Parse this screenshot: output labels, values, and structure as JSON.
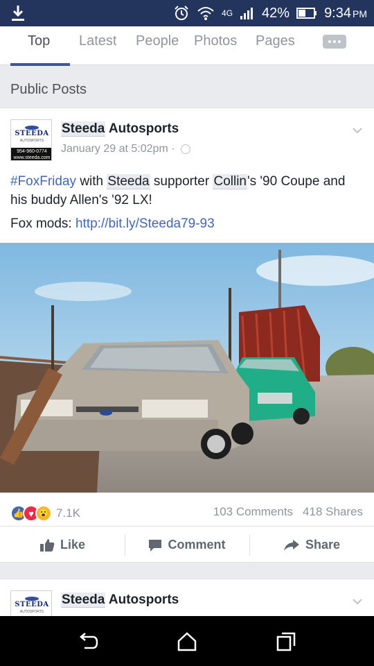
{
  "status_bar": {
    "network": "4G",
    "battery": "42%",
    "time": "9:34",
    "ampm": "PM",
    "icons": [
      "download-icon",
      "alarm-icon",
      "wifi-icon",
      "signal-icon",
      "battery-icon"
    ]
  },
  "tabs": [
    "Top",
    "Latest",
    "People",
    "Photos",
    "Pages"
  ],
  "section_title": "Public Posts",
  "post": {
    "logo": {
      "brand": "STEEDA",
      "sub": "AUTOSPORTS",
      "phone": "954-960-0774",
      "web": "www.steeda.com"
    },
    "poster_first": "Steeda",
    "poster_rest": "Autosports",
    "timestamp": "January 29 at 5:02pm ·",
    "text": {
      "hashtag": "#FoxFriday",
      "p1": "with",
      "mention1": "Steeda",
      "p2": "supporter",
      "mention2": "Collin",
      "p3": "'s '90 Coupe and his buddy Allen's '92 LX!",
      "mods_label": "Fox mods:",
      "mods_link": "http://bit.ly/Steeda79-93"
    },
    "reaction_count": "7.1K",
    "comments": "103 Comments",
    "shares": "418 Shares",
    "actions": {
      "like": "Like",
      "comment": "Comment",
      "share": "Share"
    }
  },
  "post2": {
    "poster_first": "Steeda",
    "poster_rest": "Autosports"
  },
  "colors": {
    "statusbar": "#23355d",
    "accent": "#3b5998",
    "link": "#4267b2"
  }
}
